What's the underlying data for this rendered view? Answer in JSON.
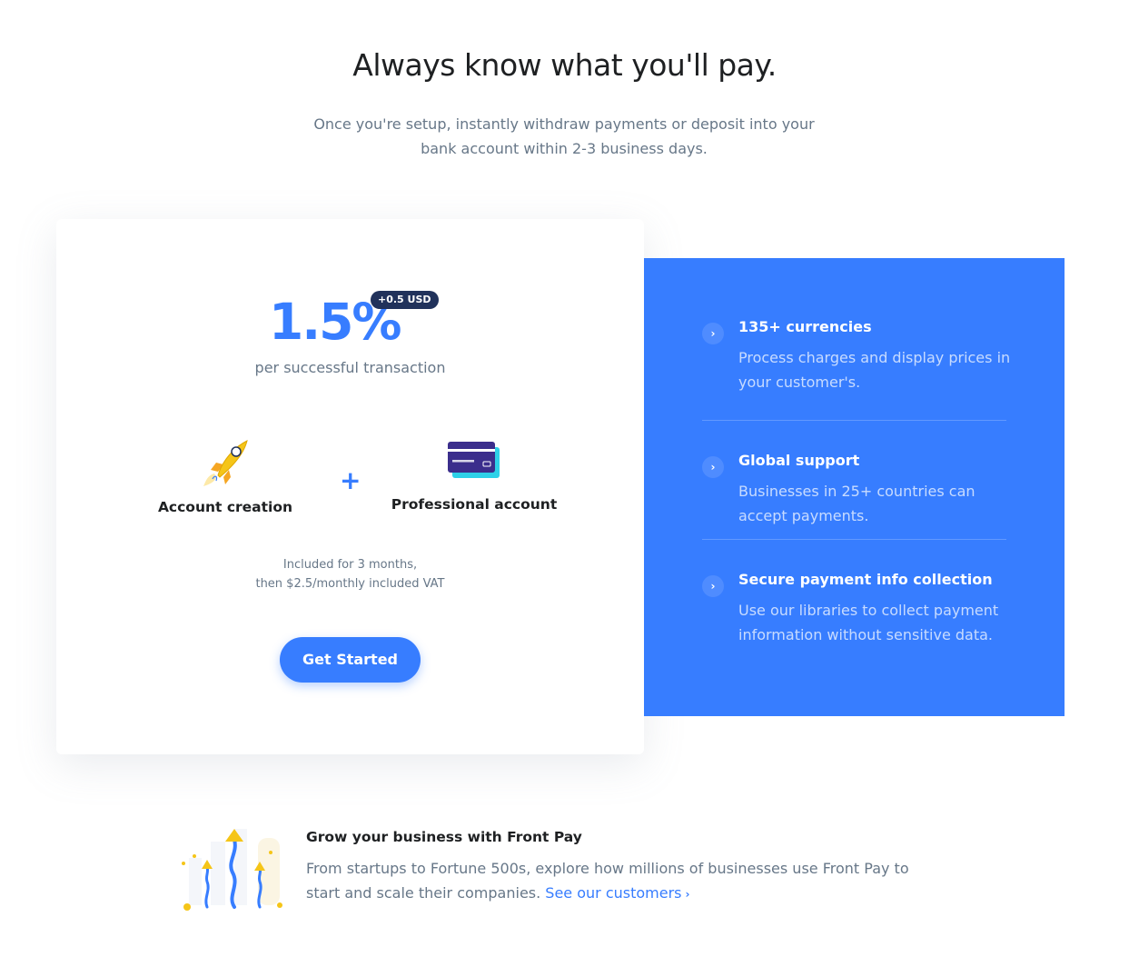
{
  "header": {
    "title": "Always know what you'll pay.",
    "subtitle_line1": "Once you're setup, instantly withdraw payments or deposit into your",
    "subtitle_line2": "bank account within 2-3 business days."
  },
  "pricing_card": {
    "price": "1.5%",
    "badge": "+0.5 USD",
    "price_caption": "per successful transaction",
    "features": [
      {
        "label": "Account creation",
        "icon": "rocket-icon"
      },
      {
        "label": "Professional account",
        "icon": "credit-card-icon"
      }
    ],
    "plus_symbol": "+",
    "included_line1": "Included for 3 months,",
    "included_line2": "then $2.5/monthly included VAT",
    "cta_label": "Get Started"
  },
  "benefits": {
    "background_color": "#377dff",
    "items": [
      {
        "title": "135+ currencies",
        "description": "Process charges and display prices in your customer's.",
        "icon": "chevron-right-icon"
      },
      {
        "title": "Global support",
        "description": "Businesses in 25+ countries can accept payments.",
        "icon": "chevron-right-icon"
      },
      {
        "title": "Secure payment info collection",
        "description": "Use our libraries to collect payment information without sensitive data.",
        "icon": "chevron-right-icon"
      }
    ]
  },
  "grow": {
    "title": "Grow your business with Front Pay",
    "text": "From startups to Fortune 500s, explore how millions of businesses use Front Pay to start and scale their companies.",
    "link_label": "See our customers",
    "link_icon": "chevron-right-icon",
    "illustration": "growth-arrows-illustration"
  },
  "colors": {
    "primary": "#377dff",
    "dark": "#1e2022",
    "muted": "#677788",
    "badge": "#21325b",
    "accent_yellow": "#f5c518"
  }
}
